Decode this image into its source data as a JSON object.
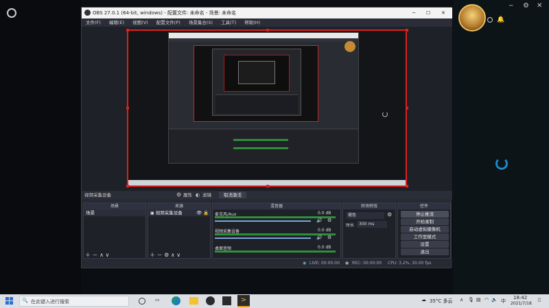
{
  "window": {
    "title": "OBS 27.0.1 (64-bit, windows) - 配置文件: 未命名 - 场景: 未命名",
    "controls": {
      "minimize": "─",
      "maximize": "☐",
      "close": "✕"
    }
  },
  "menu": [
    "文件(F)",
    "编辑(E)",
    "视图(V)",
    "配置文件(P)",
    "场景集合(S)",
    "工具(T)",
    "帮助(H)"
  ],
  "source_toolbar": {
    "source_name": "视频采集设备",
    "properties_label": "属性",
    "filters_label": "滤镜",
    "deactivate_label": "取消激活"
  },
  "docks": {
    "scenes": {
      "title": "场景",
      "items": [
        "场景"
      ]
    },
    "sources": {
      "title": "来源",
      "items": [
        "视频采集设备"
      ]
    },
    "mixer": {
      "title": "混音器",
      "channels": [
        {
          "name": "麦克风/Aux",
          "db": "0.0 dB"
        },
        {
          "name": "视频采集设备",
          "db": "0.0 dB"
        },
        {
          "name": "桌面音频",
          "db": "0.0 dB"
        }
      ]
    },
    "transitions": {
      "title": "转场特效",
      "type": "褪色",
      "duration_label": "时长",
      "duration_value": "300 ms"
    },
    "controls": {
      "title": "控件",
      "buttons": [
        "停止推流",
        "开始录制",
        "启动虚拟摄像机",
        "工作室模式",
        "设置",
        "退出"
      ]
    }
  },
  "status": {
    "live": "LIVE: 00:00:00",
    "rec": "REC: 00:00:00",
    "cpu": "CPU: 3.2%, 30.00 fps"
  },
  "taskbar": {
    "search_placeholder": "在此键入进行搜索",
    "weather": "35°C 多云",
    "ime": "中",
    "time": "18:42",
    "date": "2021/7/18"
  },
  "colors": {
    "accent_red": "#e0201c",
    "meter_green": "#2f8f3a",
    "meter_yellow": "#b8b02a"
  }
}
